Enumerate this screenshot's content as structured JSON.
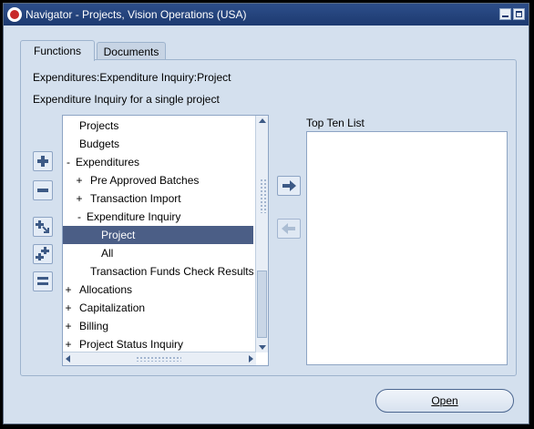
{
  "window": {
    "title": "Navigator - Projects, Vision Operations (USA)"
  },
  "tabs": [
    {
      "label": "Functions",
      "active": true
    },
    {
      "label": "Documents",
      "active": false
    }
  ],
  "panel": {
    "breadcrumb": "Expenditures:Expenditure Inquiry:Project",
    "description": "Expenditure Inquiry for a single project"
  },
  "tree": {
    "items": [
      {
        "expander": "",
        "label": "Projects"
      },
      {
        "expander": "",
        "label": "Budgets"
      },
      {
        "expander": "-",
        "label": "Expenditures"
      },
      {
        "expander": "+",
        "label": "Pre Approved Batches"
      },
      {
        "expander": "+",
        "label": "Transaction Import"
      },
      {
        "expander": "-",
        "label": "Expenditure Inquiry"
      },
      {
        "expander": "",
        "label": "Project",
        "selected": true
      },
      {
        "expander": "",
        "label": "All"
      },
      {
        "expander": "",
        "label": "Transaction Funds Check Results"
      },
      {
        "expander": "+",
        "label": "Allocations"
      },
      {
        "expander": "+",
        "label": "Capitalization"
      },
      {
        "expander": "+",
        "label": "Billing"
      },
      {
        "expander": "+",
        "label": "Project Status Inquiry"
      }
    ]
  },
  "top_ten": {
    "label": "Top Ten List"
  },
  "buttons": {
    "open_label": "Open"
  },
  "colors": {
    "titlebar": "#1d3a70",
    "background": "#d4e0ee",
    "selection": "#4b5e86",
    "icon": "#3d5a86"
  }
}
